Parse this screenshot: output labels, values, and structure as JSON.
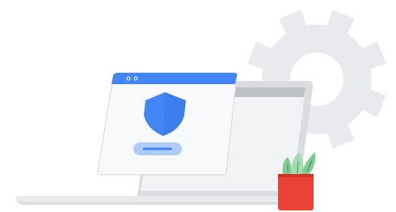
{
  "colors": {
    "background": "#ffffff",
    "gear": "#e8eaed",
    "laptop_frame": "#dadce0",
    "laptop_screen": "#f1f3f4",
    "laptop_titlebar": "#bdc1c6",
    "laptop_base": "#e8eaed",
    "window_bg": "#f8f9fa",
    "window_border": "#dadce0",
    "window_titlebar": "#4285f4",
    "shield": "#4285f4",
    "shield_highlight": "#3367d6",
    "button_bg": "#aecbfa",
    "button_line": "#4285f4",
    "pot": "#ea4335",
    "plant": "#81c995",
    "plant_dark": "#34a853"
  },
  "icons": {
    "gear": "gear-icon",
    "shield": "shield-icon",
    "plant": "cactus-plant-icon"
  }
}
